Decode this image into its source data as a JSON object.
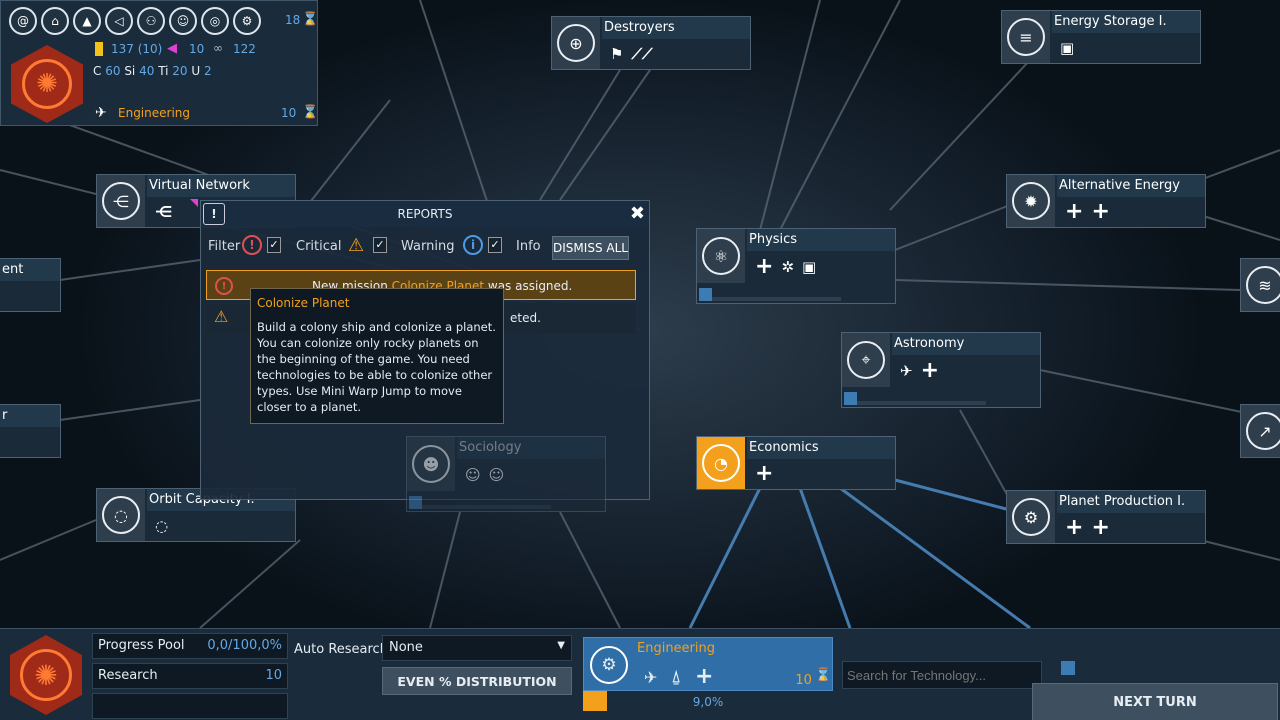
{
  "empire": {
    "top_icons": [
      "galaxy-icon",
      "government-icon",
      "rocket-icon",
      "megaphone-icon",
      "handshake-icon",
      "people-icon",
      "target-icon",
      "gear-icon"
    ],
    "turns": "18",
    "credits": "137 (10)",
    "influence": "10",
    "research_pts": "122",
    "resources": {
      "C": "60",
      "Si": "40",
      "Ti": "20",
      "U": "2"
    },
    "current_research": "Engineering",
    "current_research_turns": "10"
  },
  "nodes": {
    "destroyers": "Destroyers",
    "energy_storage": "Energy Storage I.",
    "virtual_network": "Virtual Network",
    "alternative_energy": "Alternative Energy",
    "physics": "Physics",
    "astronomy": "Astronomy",
    "economics": "Economics",
    "planet_production": "Planet Production I.",
    "orbit_capacity": "Orbit Capacity I.",
    "sociology": "Sociology",
    "left_edge_1": "ent",
    "left_edge_2": "r"
  },
  "reports": {
    "title": "REPORTS",
    "filter_label": "Filter",
    "critical_label": "Critical",
    "warning_label": "Warning",
    "info_label": "Info",
    "dismiss_all": "DISMISS ALL",
    "msg1_pre": "New mission ",
    "msg1_link": "Colonize Planet",
    "msg1_post": " was assigned.",
    "msg2_tail": "eted."
  },
  "tooltip": {
    "title": "Colonize Planet",
    "body": "Build a colony ship and colonize a planet. You can colonize only rocky planets on the beginning of the game. You need technologies to be able to colonize other types. Use Mini Warp Jump to move closer to a planet."
  },
  "bottom": {
    "progress_pool_label": "Progress Pool",
    "progress_pool_value": "0,0/100,0%",
    "research_label": "Research",
    "research_value": "10",
    "auto_research_label": "Auto Research",
    "auto_research_value": "None",
    "even_distribution": "EVEN % DISTRIBUTION",
    "current_tech": "Engineering",
    "current_tech_turns": "10",
    "current_tech_progress": "9,0%",
    "search_placeholder": "Search for Technology...",
    "next_turn": "NEXT TURN"
  },
  "colors": {
    "accent_orange": "#f3a11c",
    "accent_blue": "#62a9e6",
    "panel_bg": "#1b2a39",
    "emblem_red": "#9f2a18"
  }
}
